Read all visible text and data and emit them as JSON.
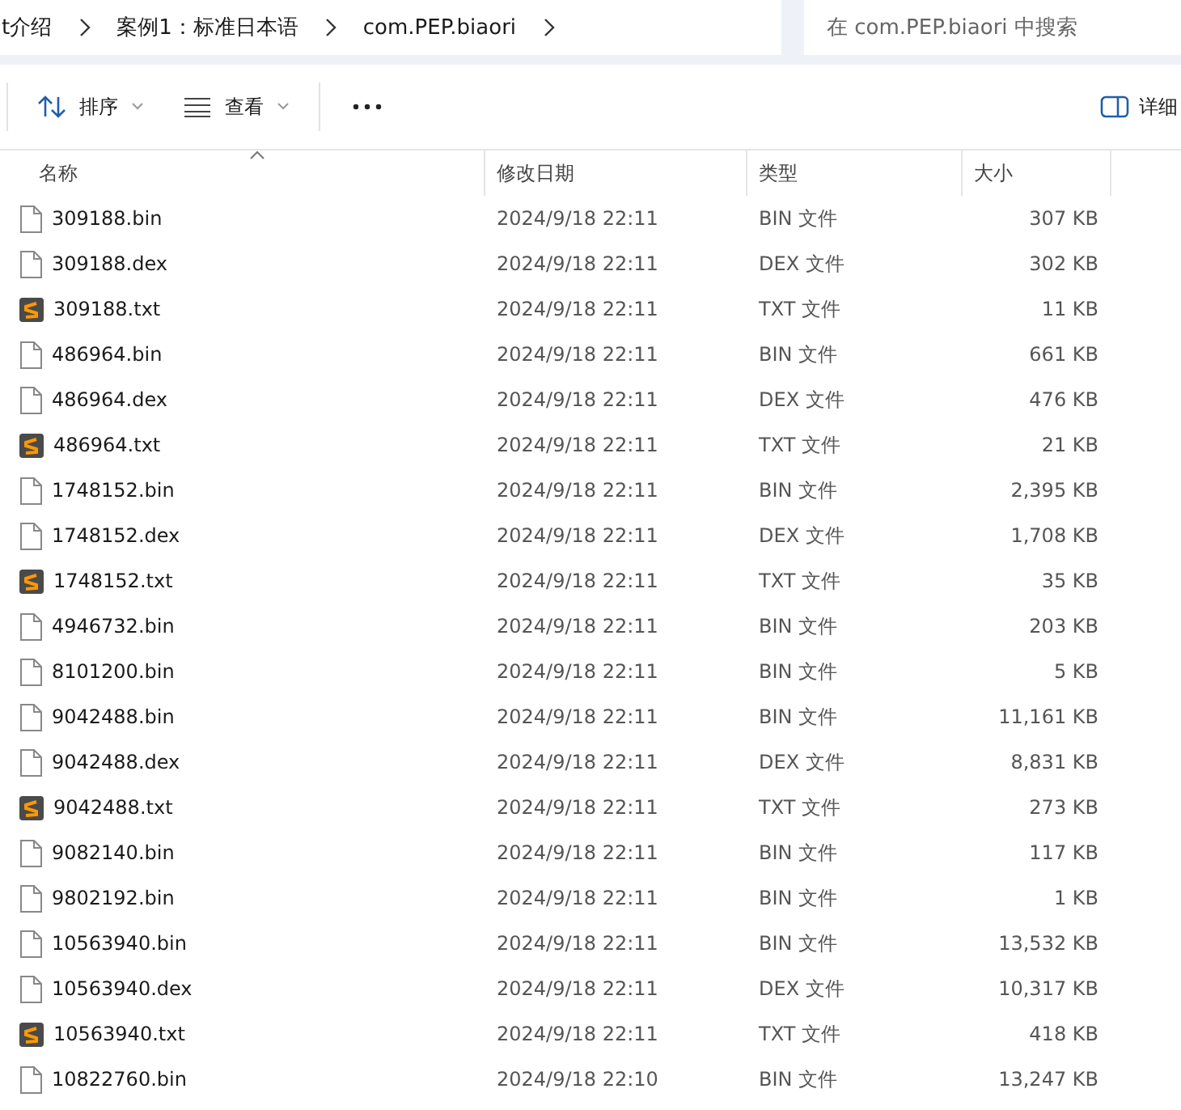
{
  "address_bar": {
    "breadcrumbs": [
      "t介绍",
      "案例1：标准日本语",
      "com.PEP.biaori"
    ]
  },
  "search": {
    "placeholder": "在 com.PEP.biaori 中搜索"
  },
  "toolbar": {
    "sort": "排序",
    "view": "查看",
    "details": "详细"
  },
  "table": {
    "columns": [
      {
        "label": "名称",
        "sorted": true
      },
      {
        "label": "修改日期",
        "sorted": false
      },
      {
        "label": "类型",
        "sorted": false
      },
      {
        "label": "大小",
        "sorted": false
      }
    ],
    "rows": [
      {
        "kind": "blank",
        "name": "309188.bin",
        "date": "2024/9/18 22:11",
        "type": "BIN 文件",
        "size": "307 KB"
      },
      {
        "kind": "blank",
        "name": "309188.dex",
        "date": "2024/9/18 22:11",
        "type": "DEX 文件",
        "size": "302 KB"
      },
      {
        "kind": "editor",
        "name": "309188.txt",
        "date": "2024/9/18 22:11",
        "type": "TXT 文件",
        "size": "11 KB"
      },
      {
        "kind": "blank",
        "name": "486964.bin",
        "date": "2024/9/18 22:11",
        "type": "BIN 文件",
        "size": "661 KB"
      },
      {
        "kind": "blank",
        "name": "486964.dex",
        "date": "2024/9/18 22:11",
        "type": "DEX 文件",
        "size": "476 KB"
      },
      {
        "kind": "editor",
        "name": "486964.txt",
        "date": "2024/9/18 22:11",
        "type": "TXT 文件",
        "size": "21 KB"
      },
      {
        "kind": "blank",
        "name": "1748152.bin",
        "date": "2024/9/18 22:11",
        "type": "BIN 文件",
        "size": "2,395 KB"
      },
      {
        "kind": "blank",
        "name": "1748152.dex",
        "date": "2024/9/18 22:11",
        "type": "DEX 文件",
        "size": "1,708 KB"
      },
      {
        "kind": "editor",
        "name": "1748152.txt",
        "date": "2024/9/18 22:11",
        "type": "TXT 文件",
        "size": "35 KB"
      },
      {
        "kind": "blank",
        "name": "4946732.bin",
        "date": "2024/9/18 22:11",
        "type": "BIN 文件",
        "size": "203 KB"
      },
      {
        "kind": "blank",
        "name": "8101200.bin",
        "date": "2024/9/18 22:11",
        "type": "BIN 文件",
        "size": "5 KB"
      },
      {
        "kind": "blank",
        "name": "9042488.bin",
        "date": "2024/9/18 22:11",
        "type": "BIN 文件",
        "size": "11,161 KB"
      },
      {
        "kind": "blank",
        "name": "9042488.dex",
        "date": "2024/9/18 22:11",
        "type": "DEX 文件",
        "size": "8,831 KB"
      },
      {
        "kind": "editor",
        "name": "9042488.txt",
        "date": "2024/9/18 22:11",
        "type": "TXT 文件",
        "size": "273 KB"
      },
      {
        "kind": "blank",
        "name": "9082140.bin",
        "date": "2024/9/18 22:11",
        "type": "BIN 文件",
        "size": "117 KB"
      },
      {
        "kind": "blank",
        "name": "9802192.bin",
        "date": "2024/9/18 22:11",
        "type": "BIN 文件",
        "size": "1 KB"
      },
      {
        "kind": "blank",
        "name": "10563940.bin",
        "date": "2024/9/18 22:11",
        "type": "BIN 文件",
        "size": "13,532 KB"
      },
      {
        "kind": "blank",
        "name": "10563940.dex",
        "date": "2024/9/18 22:11",
        "type": "DEX 文件",
        "size": "10,317 KB"
      },
      {
        "kind": "editor",
        "name": "10563940.txt",
        "date": "2024/9/18 22:11",
        "type": "TXT 文件",
        "size": "418 KB"
      },
      {
        "kind": "blank",
        "name": "10822760.bin",
        "date": "2024/9/18 22:10",
        "type": "BIN 文件",
        "size": "13,247 KB"
      }
    ]
  }
}
